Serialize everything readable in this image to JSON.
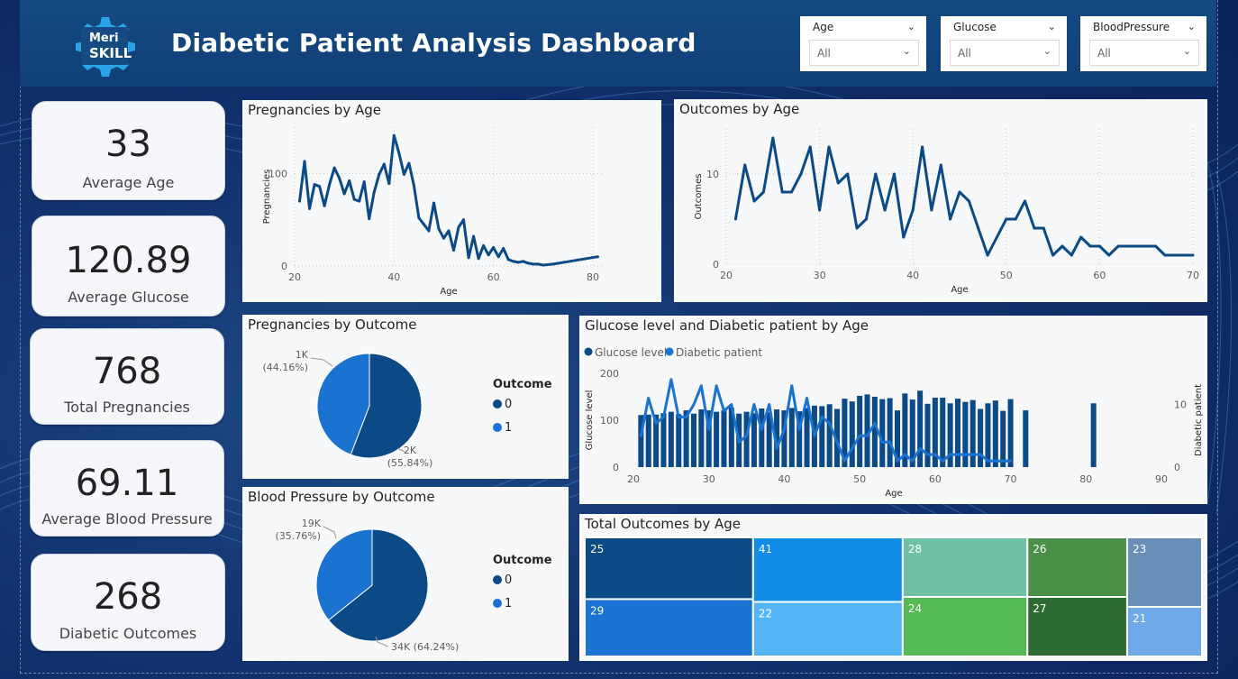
{
  "header": {
    "logo_text_1": "Meri",
    "logo_text_2": "SKILL",
    "title": "Diabetic Patient Analysis Dashboard"
  },
  "slicers": [
    {
      "label": "Age",
      "value": "All"
    },
    {
      "label": "Glucose",
      "value": "All"
    },
    {
      "label": "BloodPressure",
      "value": "All"
    }
  ],
  "kpis": [
    {
      "value": "33",
      "label": "Average Age"
    },
    {
      "value": "120.89",
      "label": "Average Glucose"
    },
    {
      "value": "768",
      "label": "Total Pregnancies"
    },
    {
      "value": "69.11",
      "label": "Average Blood Pressure"
    },
    {
      "value": "268",
      "label": "Diabetic Outcomes"
    }
  ],
  "colors": {
    "dark_blue": "#0b4a87",
    "mid_blue": "#1a72d1",
    "accent": "#1565c0"
  },
  "chart_data": [
    {
      "type": "line",
      "title": "Pregnancies by Age",
      "xlabel": "Age",
      "ylabel": "Pregnancies",
      "xlim": [
        20,
        82
      ],
      "ylim": [
        0,
        150
      ],
      "x_ticks": [
        20,
        40,
        60,
        80
      ],
      "y_ticks": [
        0,
        100
      ],
      "x": [
        21,
        22,
        23,
        24,
        25,
        26,
        27,
        28,
        29,
        30,
        31,
        32,
        33,
        34,
        35,
        36,
        37,
        38,
        39,
        40,
        41,
        42,
        43,
        44,
        45,
        46,
        47,
        48,
        49,
        50,
        51,
        52,
        53,
        54,
        55,
        56,
        57,
        58,
        59,
        60,
        61,
        62,
        63,
        64,
        65,
        66,
        67,
        68,
        69,
        70,
        72,
        81
      ],
      "y": [
        70,
        113,
        62,
        88,
        86,
        65,
        88,
        106,
        95,
        78,
        92,
        72,
        70,
        91,
        51,
        80,
        99,
        110,
        89,
        141,
        122,
        99,
        111,
        87,
        52,
        45,
        38,
        68,
        40,
        30,
        38,
        17,
        42,
        50,
        9,
        32,
        8,
        22,
        12,
        20,
        10,
        19,
        7,
        5,
        4,
        5,
        3,
        2,
        2,
        1,
        2,
        10
      ]
    },
    {
      "type": "line",
      "title": "Outcomes by Age",
      "xlabel": "Age",
      "ylabel": "Outcomes",
      "xlim": [
        20,
        70
      ],
      "ylim": [
        0,
        15
      ],
      "x_ticks": [
        20,
        30,
        40,
        50,
        60,
        70
      ],
      "y_ticks": [
        0,
        10
      ],
      "x": [
        21,
        22,
        23,
        24,
        25,
        26,
        27,
        28,
        29,
        30,
        31,
        32,
        33,
        34,
        35,
        36,
        37,
        38,
        39,
        40,
        41,
        42,
        43,
        44,
        45,
        46,
        47,
        48,
        49,
        50,
        51,
        52,
        53,
        54,
        55,
        56,
        57,
        58,
        59,
        60,
        61,
        62,
        63,
        64,
        65,
        66,
        67,
        68,
        69,
        70
      ],
      "y": [
        5,
        11,
        7,
        8,
        14,
        8,
        8,
        10,
        13,
        6,
        13,
        9,
        10,
        4,
        5,
        10,
        6,
        10,
        3,
        6,
        13,
        6,
        11,
        5,
        8,
        7,
        4,
        1,
        3,
        5,
        5,
        7,
        4,
        4,
        1,
        2,
        1,
        3,
        2,
        2,
        1,
        2,
        2,
        2,
        2,
        2,
        1,
        1,
        1,
        1
      ]
    },
    {
      "type": "pie",
      "title": "Pregnancies by Outcome",
      "legend_title": "Outcome",
      "categories": [
        "0",
        "1"
      ],
      "values": [
        55.84,
        44.16
      ],
      "data_labels": [
        [
          "2K",
          "(55.84%)"
        ],
        [
          "1K",
          "(44.16%)"
        ]
      ]
    },
    {
      "type": "pie",
      "title": "Blood Pressure by Outcome",
      "legend_title": "Outcome",
      "categories": [
        "0",
        "1"
      ],
      "values": [
        64.24,
        35.76
      ],
      "data_labels": [
        [
          "34K (64.24%)"
        ],
        [
          "19K",
          "(35.76%)"
        ]
      ]
    },
    {
      "type": "bar",
      "title": "Glucose level and Diabetic patient by Age",
      "xlabel": "Age",
      "ylabel": "Glucose level",
      "y2label": "Diabetic patient",
      "legend": [
        "Glucose level",
        "Diabetic patient"
      ],
      "xlim": [
        20,
        90
      ],
      "ylim": [
        0,
        200
      ],
      "y2lim": [
        0,
        15
      ],
      "x_ticks": [
        20,
        30,
        40,
        50,
        60,
        70,
        80,
        90
      ],
      "y_ticks": [
        0,
        100,
        200
      ],
      "y2_ticks": [
        0,
        10
      ],
      "x": [
        21,
        22,
        23,
        24,
        25,
        26,
        27,
        28,
        29,
        30,
        31,
        32,
        33,
        34,
        35,
        36,
        37,
        38,
        39,
        40,
        41,
        42,
        43,
        44,
        45,
        46,
        47,
        48,
        49,
        50,
        51,
        52,
        53,
        54,
        55,
        56,
        57,
        58,
        59,
        60,
        61,
        62,
        63,
        64,
        65,
        66,
        67,
        68,
        69,
        70,
        72,
        81
      ],
      "series": [
        {
          "name": "Glucose level",
          "type": "bar",
          "values": [
            111,
            112,
            112,
            115,
            118,
            113,
            121,
            114,
            123,
            121,
            118,
            121,
            127,
            114,
            118,
            115,
            125,
            117,
            123,
            121,
            126,
            119,
            126,
            131,
            130,
            134,
            124,
            146,
            140,
            152,
            155,
            150,
            145,
            147,
            121,
            157,
            144,
            163,
            135,
            148,
            148,
            136,
            146,
            139,
            143,
            124,
            136,
            142,
            120,
            145,
            121,
            136
          ]
        },
        {
          "name": "Diabetic patient",
          "type": "line",
          "values": [
            5,
            11,
            7,
            8,
            14,
            8,
            8,
            10,
            13,
            6,
            13,
            9,
            10,
            4,
            5,
            10,
            6,
            10,
            3,
            6,
            13,
            6,
            11,
            5,
            8,
            7,
            4,
            1,
            3,
            5,
            5,
            7,
            4,
            4,
            1,
            2,
            1,
            3,
            2,
            2,
            1,
            2,
            2,
            2,
            2,
            2,
            1,
            1,
            1,
            1
          ]
        }
      ]
    },
    {
      "type": "treemap",
      "title": "Total Outcomes by Age",
      "labels": [
        "25",
        "29",
        "41",
        "22",
        "28",
        "24",
        "26",
        "27",
        "23",
        "21"
      ],
      "values": [
        14,
        13,
        13,
        11,
        10,
        10,
        8,
        8,
        7,
        5
      ]
    }
  ]
}
